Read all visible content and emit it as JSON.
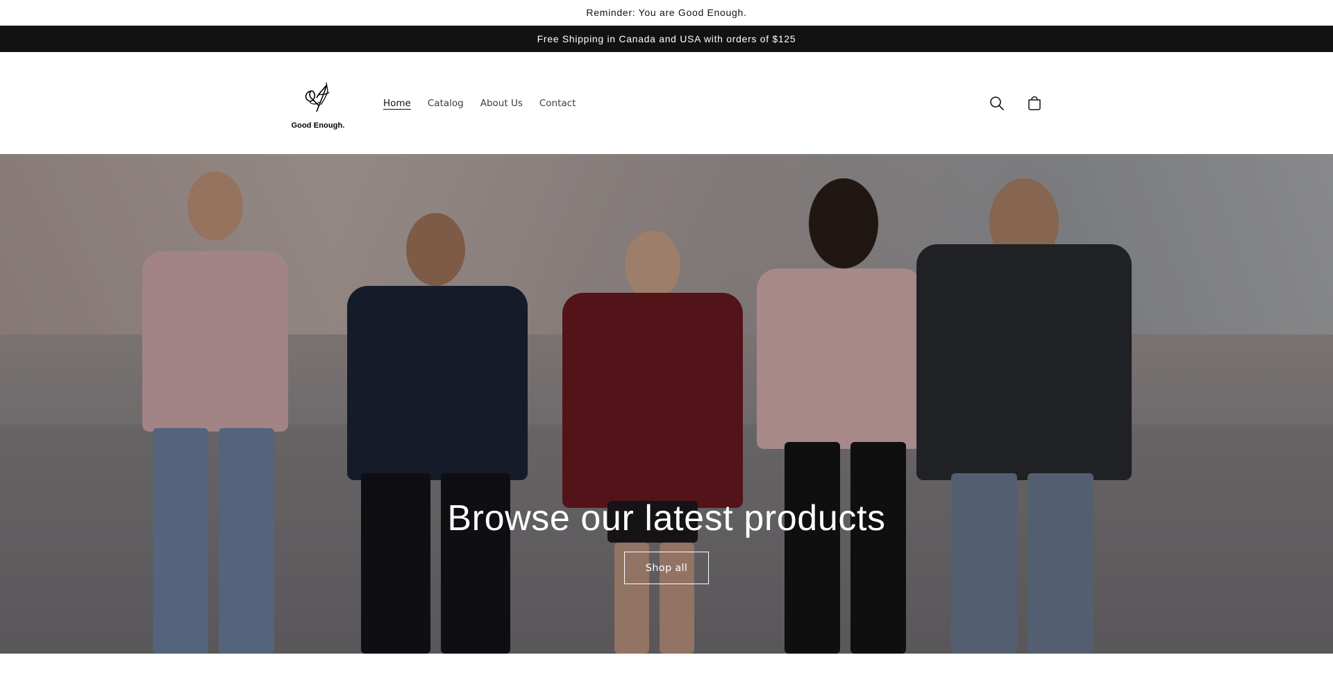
{
  "announcements": {
    "reminder": "Reminder: You are Good Enough.",
    "shipping": "Free Shipping in Canada and USA with orders of $125"
  },
  "header": {
    "logo_text": "Good Enough.",
    "nav": [
      {
        "label": "Home",
        "active": true
      },
      {
        "label": "Catalog",
        "active": false
      },
      {
        "label": "About Us",
        "active": false
      },
      {
        "label": "Contact",
        "active": false
      }
    ],
    "icons": [
      "search-icon",
      "cart-icon"
    ]
  },
  "hero": {
    "title": "Browse our latest products",
    "button_label": "Shop all"
  },
  "colors": {
    "announcement_bar_dark": "#121212",
    "text": "#121212",
    "hero_text": "#ffffff"
  }
}
